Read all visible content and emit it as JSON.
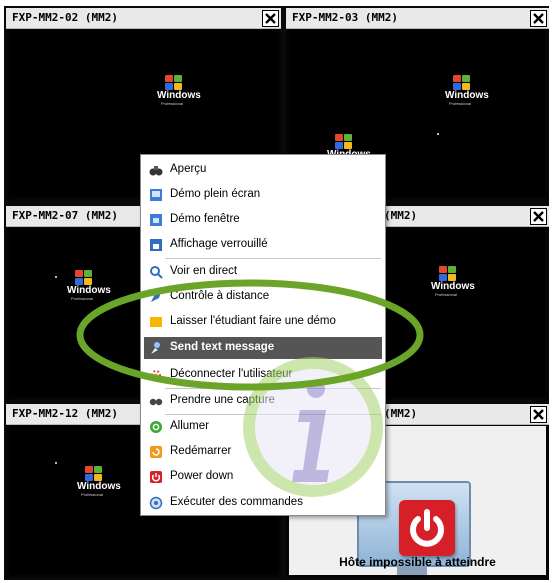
{
  "tiles": [
    {
      "title": "FXP-MM2-02 (MM2)",
      "close_icon": "close-icon"
    },
    {
      "title": "FXP-MM2-03 (MM2)",
      "close_icon": "close-icon"
    },
    {
      "title": "FXP-MM2-07 (MM2)",
      "close_icon": "close-icon"
    },
    {
      "title": "(MM2)",
      "close_icon": "close-icon"
    },
    {
      "title": "FXP-MM2-12 (MM2)",
      "close_icon": "close-icon"
    },
    {
      "title": "(MM2)",
      "close_icon": "close-icon",
      "status": "Hôte impossible à atteindre"
    }
  ],
  "screen_logo": {
    "word": "Windows",
    "sub": "Professional"
  },
  "context_menu": {
    "items": [
      {
        "label": "Aperçu",
        "icon": "binoculars-icon"
      },
      {
        "label": "Démo plein écran",
        "icon": "demo-fullscreen-icon"
      },
      {
        "label": "Démo fenêtre",
        "icon": "demo-window-icon"
      },
      {
        "label": "Affichage verrouillé",
        "icon": "lock-screen-icon"
      },
      {
        "label": "Voir en direct",
        "icon": "magnifier-icon"
      },
      {
        "label": "Contrôle à distance",
        "icon": "remote-control-icon"
      },
      {
        "label": "Laisser l'étudiant faire une démo",
        "icon": "student-demo-icon"
      },
      {
        "label": "Send text message",
        "icon": "message-icon"
      },
      {
        "label": "Déconnecter l'utilisateur",
        "icon": "logoff-icon"
      },
      {
        "label": "Prendre une capture",
        "icon": "camera-icon"
      },
      {
        "label": "Allumer",
        "icon": "power-on-icon"
      },
      {
        "label": "Redémarrer",
        "icon": "restart-icon"
      },
      {
        "label": "Power down",
        "icon": "power-down-icon"
      },
      {
        "label": "Exécuter des commandes",
        "icon": "run-commands-icon"
      }
    ],
    "selected_index": 7
  },
  "colors": {
    "selection": "#555555",
    "highlight_ring": "#6aa52a",
    "info_watermark": "#8a7fc8",
    "offline_icon": "#d61f26"
  }
}
